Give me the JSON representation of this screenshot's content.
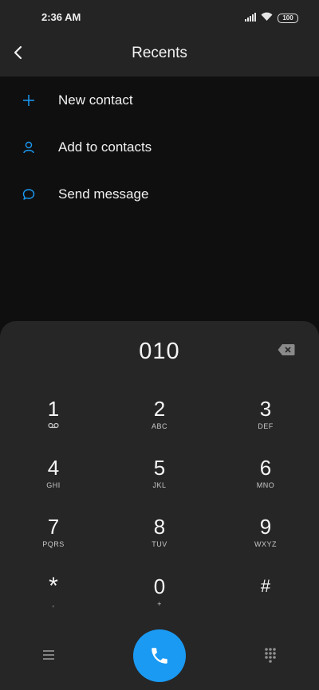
{
  "status_bar": {
    "time": "2:36 AM",
    "battery": "100"
  },
  "header": {
    "title": "Recents"
  },
  "actions": [
    {
      "label": "New contact",
      "icon": "plus-icon"
    },
    {
      "label": "Add to contacts",
      "icon": "person-icon"
    },
    {
      "label": "Send message",
      "icon": "message-icon"
    }
  ],
  "dialpad": {
    "number": "010",
    "keys": [
      {
        "digit": "1",
        "letters": ""
      },
      {
        "digit": "2",
        "letters": "ABC"
      },
      {
        "digit": "3",
        "letters": "DEF"
      },
      {
        "digit": "4",
        "letters": "GHI"
      },
      {
        "digit": "5",
        "letters": "JKL"
      },
      {
        "digit": "6",
        "letters": "MNO"
      },
      {
        "digit": "7",
        "letters": "PQRS"
      },
      {
        "digit": "8",
        "letters": "TUV"
      },
      {
        "digit": "9",
        "letters": "WXYZ"
      },
      {
        "digit": "*",
        "letters": ","
      },
      {
        "digit": "0",
        "letters": "+"
      },
      {
        "digit": "#",
        "letters": ""
      }
    ]
  },
  "colors": {
    "accent": "#1a9af3",
    "header_bg": "#242425",
    "body_bg": "#0f0f10",
    "dialpad_bg": "#262627"
  }
}
